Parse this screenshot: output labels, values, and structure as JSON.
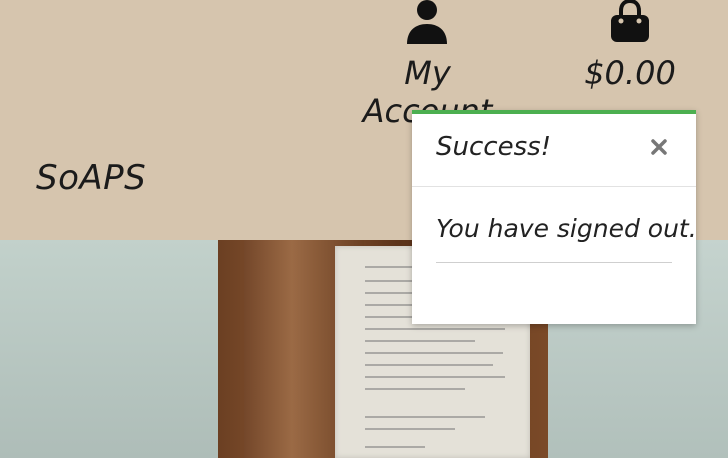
{
  "header": {
    "brand": "SoAPS",
    "account": {
      "label": "My Account",
      "icon": "user-icon"
    },
    "bag": {
      "label": "$0.00",
      "icon": "shopping-bag-icon"
    }
  },
  "toast": {
    "title": "Success!",
    "message": "You have signed out.",
    "close_icon": "close-icon",
    "accent_color": "#4caf50"
  },
  "colors": {
    "header_bg": "#d6c5ae",
    "toast_bg": "#ffffff"
  }
}
